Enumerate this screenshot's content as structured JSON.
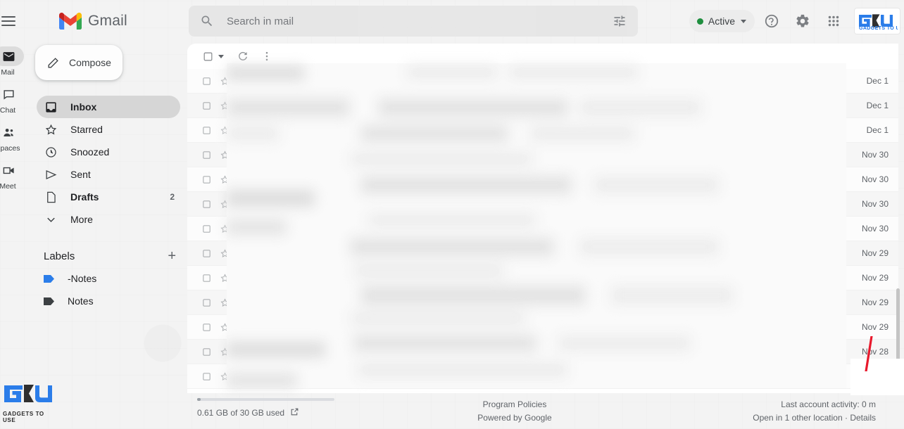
{
  "app": {
    "brand": "Gmail",
    "watermark": "GADGETS TO USE"
  },
  "topbar": {
    "menu_icon": "hamburger-icon",
    "logo_icon": "gmail-logo-icon",
    "search": {
      "icon": "search-icon",
      "placeholder": "Search in mail",
      "value": "",
      "filter_icon": "filter-options-icon"
    },
    "status": {
      "label": "Active",
      "dot_color": "#1e8e3e",
      "caret_icon": "chevron-down-icon"
    },
    "help_icon": "help-circle-icon",
    "settings_icon": "gear-icon",
    "apps_icon": "apps-grid-icon",
    "account_logo": "gadgets-to-use-logo"
  },
  "rail": {
    "items": [
      {
        "label": "Mail",
        "icon": "mail-icon",
        "active": true
      },
      {
        "label": "Chat",
        "icon": "chat-icon",
        "active": false
      },
      {
        "label": "Spaces",
        "icon": "spaces-icon",
        "active": false
      },
      {
        "label": "Meet",
        "icon": "meet-camera-icon",
        "active": false
      }
    ]
  },
  "sidebar": {
    "compose": {
      "label": "Compose",
      "icon": "pencil-icon"
    },
    "nav": [
      {
        "label": "Inbox",
        "icon": "inbox-icon",
        "active": true,
        "bold": true,
        "count": ""
      },
      {
        "label": "Starred",
        "icon": "star-icon",
        "active": false,
        "bold": false,
        "count": ""
      },
      {
        "label": "Snoozed",
        "icon": "clock-icon",
        "active": false,
        "bold": false,
        "count": ""
      },
      {
        "label": "Sent",
        "icon": "send-icon",
        "active": false,
        "bold": false,
        "count": ""
      },
      {
        "label": "Drafts",
        "icon": "draft-icon",
        "active": false,
        "bold": true,
        "count": "2"
      },
      {
        "label": "More",
        "icon": "chevron-down-icon",
        "active": false,
        "bold": false,
        "count": ""
      }
    ],
    "labels_title": "Labels",
    "labels_add_icon": "plus-icon",
    "labels": [
      {
        "label": "-Notes",
        "color": "#2b7de9"
      },
      {
        "label": "Notes",
        "color": "#3c4043"
      }
    ]
  },
  "list_toolbar": {
    "select_all_icon": "checkbox-icon",
    "select_caret_icon": "chevron-down-icon",
    "refresh_icon": "refresh-icon",
    "more_icon": "more-vertical-icon"
  },
  "mail_list": {
    "rows": [
      {
        "sender": "De",
        "date": "Dec 1",
        "redacted": true
      },
      {
        "sender": "Lav",
        "date": "Dec 1",
        "redacted": true
      },
      {
        "sender": "De",
        "date": "Dec 1",
        "redacted": true
      },
      {
        "sender": "clo",
        "date": "Nov 30",
        "redacted": true
      },
      {
        "sender": "Ro",
        "date": "Nov 30",
        "redacted": true
      },
      {
        "sender": "Ro",
        "date": "Nov 30",
        "redacted": true
      },
      {
        "sender": "De",
        "date": "Nov 30",
        "redacted": true
      },
      {
        "sender": "Su",
        "date": "Nov 29",
        "redacted": true
      },
      {
        "sender": "Ro",
        "date": "Nov 29",
        "redacted": true
      },
      {
        "sender": "Ro",
        "date": "Nov 29",
        "redacted": true
      },
      {
        "sender": "Ro",
        "date": "Nov 29",
        "redacted": true
      },
      {
        "sender": "Me",
        "date": "Nov 28",
        "redacted": true
      },
      {
        "sender": "Aja",
        "date": "",
        "redacted": true
      }
    ]
  },
  "footer": {
    "storage_text": "0.61 GB of 30 GB used",
    "storage_link_icon": "open-in-new-icon",
    "program_policies": "Program Policies",
    "powered_by": "Powered by Google",
    "last_activity": "Last account activity: 0 m",
    "open_elsewhere": "Open in 1 other location · Details"
  }
}
